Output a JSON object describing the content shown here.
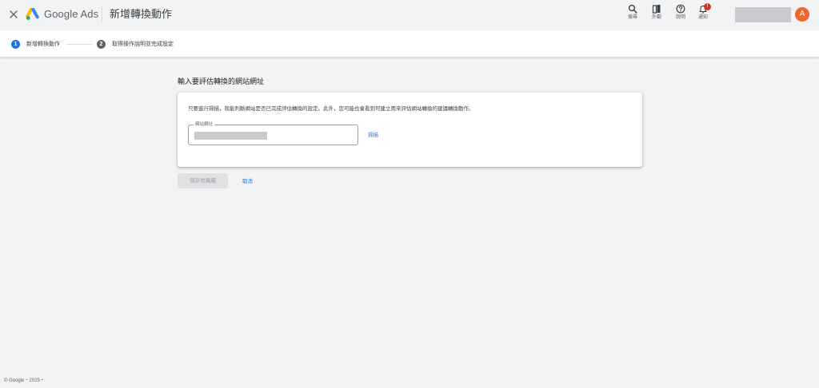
{
  "header": {
    "product_name": "Google Ads",
    "page_title": "新增轉換動作",
    "close_icon": "close-icon",
    "logo_icon": "google-ads-logo-icon",
    "tools": [
      {
        "label": "搜尋",
        "icon": "search-icon"
      },
      {
        "label": "外觀",
        "icon": "appearance-icon"
      },
      {
        "label": "說明",
        "icon": "help-icon"
      },
      {
        "label": "通知",
        "icon": "notifications-icon",
        "badge": "!"
      }
    ],
    "avatar_letter": "A",
    "colors": {
      "avatar": "#f0672b",
      "badge": "#d93025"
    }
  },
  "stepper": {
    "steps": [
      {
        "number": "1",
        "label": "新增轉換動作",
        "active": true
      },
      {
        "number": "2",
        "label": "取得操作說明並完成設定",
        "active": false
      }
    ],
    "colors": {
      "active": "#1a73e8",
      "inactive": "#5f6368"
    }
  },
  "main": {
    "section_title": "輸入要評估轉換的網站網址",
    "description": "只要進行掃描，就能判斷網站是否已完成評估轉換的設定。此外，您可能也會看到可建立用來評估網站轉換的建議轉換動作。",
    "url_field": {
      "label": "網站網址"
    },
    "scan_label": "掃描",
    "save_label": "儲存並繼續",
    "cancel_label": "取消",
    "colors": {
      "link": "#1a73e8"
    }
  },
  "footer": {
    "text": "© Google・2025・"
  }
}
